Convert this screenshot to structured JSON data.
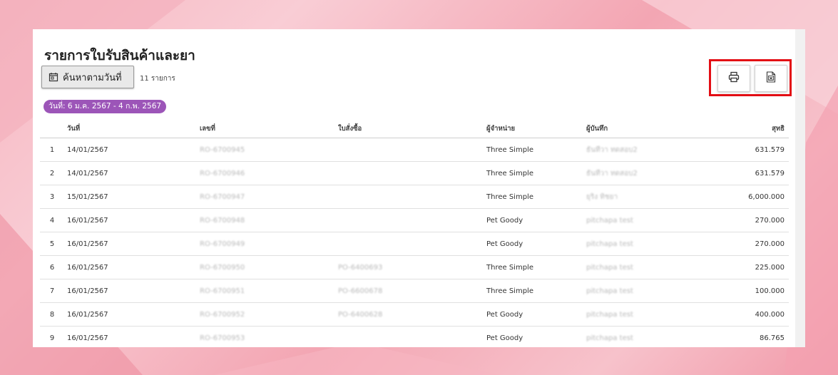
{
  "page": {
    "title": "รายการใบรับสินค้าและยา",
    "search_button_label": "ค้นหาตามวันที่",
    "record_count": "11 รายการ",
    "date_range": "วันที่: 6 ม.ค. 2567 - 4 ก.พ. 2567",
    "icons": {
      "search": "calendar-icon",
      "print": "printer-icon",
      "export": "excel-file-icon"
    },
    "colors": {
      "badge": "#9c55b8",
      "highlight": "#e30d14"
    }
  },
  "table": {
    "headers": {
      "date": "วันที่",
      "doc_no": "เลขที่",
      "po": "ใบสั่งซื้อ",
      "supplier": "ผู้จำหน่าย",
      "recorder": "ผู้บันทึก",
      "net": "สุทธิ"
    },
    "rows": [
      {
        "n": "1",
        "date": "14/01/2567",
        "doc_no": "RO-6700945",
        "po": "",
        "supplier": "Three Simple",
        "recorder": "ธันทีวา ทดสอบ2",
        "net": "631.579"
      },
      {
        "n": "2",
        "date": "14/01/2567",
        "doc_no": "RO-6700946",
        "po": "",
        "supplier": "Three Simple",
        "recorder": "ธันทีวา ทดสอบ2",
        "net": "631.579"
      },
      {
        "n": "3",
        "date": "15/01/2567",
        "doc_no": "RO-6700947",
        "po": "",
        "supplier": "Three Simple",
        "recorder": "ยุริง ทิชยา",
        "net": "6,000.000"
      },
      {
        "n": "4",
        "date": "16/01/2567",
        "doc_no": "RO-6700948",
        "po": "",
        "supplier": "Pet Goody",
        "recorder": "pitchapa test",
        "net": "270.000"
      },
      {
        "n": "5",
        "date": "16/01/2567",
        "doc_no": "RO-6700949",
        "po": "",
        "supplier": "Pet Goody",
        "recorder": "pitchapa test",
        "net": "270.000"
      },
      {
        "n": "6",
        "date": "16/01/2567",
        "doc_no": "RO-6700950",
        "po": "PO-6400693",
        "supplier": "Three Simple",
        "recorder": "pitchapa test",
        "net": "225.000"
      },
      {
        "n": "7",
        "date": "16/01/2567",
        "doc_no": "RO-6700951",
        "po": "PO-6600678",
        "supplier": "Three Simple",
        "recorder": "pitchapa test",
        "net": "100.000"
      },
      {
        "n": "8",
        "date": "16/01/2567",
        "doc_no": "RO-6700952",
        "po": "PO-6400628",
        "supplier": "Pet Goody",
        "recorder": "pitchapa test",
        "net": "400.000"
      },
      {
        "n": "9",
        "date": "16/01/2567",
        "doc_no": "RO-6700953",
        "po": "",
        "supplier": "Pet Goody",
        "recorder": "pitchapa test",
        "net": "86.765"
      }
    ]
  }
}
